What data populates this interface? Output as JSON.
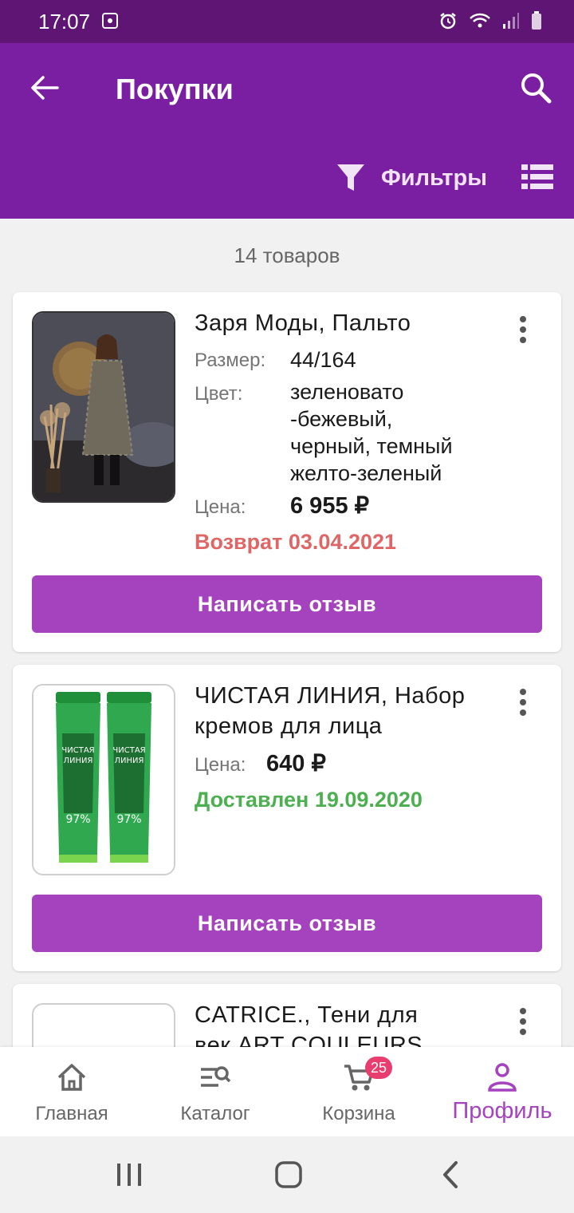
{
  "status_bar": {
    "time": "17:07"
  },
  "header": {
    "title": "Покупки",
    "filter_label": "Фильтры"
  },
  "summary": {
    "count_text": "14 товаров"
  },
  "labels": {
    "size": "Размер:",
    "color": "Цвет:",
    "price": "Цена:"
  },
  "products": [
    {
      "title": "Заря Моды, Пальто",
      "size": "44/164",
      "color_lines": [
        "зеленовато",
        "-бежевый,",
        "черный, темный",
        "желто-зеленый"
      ],
      "price": "6 955 ₽",
      "status": "Возврат 03.04.2021",
      "status_color": "#e06666",
      "button_label": "Написать отзыв"
    },
    {
      "title_lines": [
        "ЧИСТАЯ ЛИНИЯ, Набор",
        "кремов для лица"
      ],
      "price": "640 ₽",
      "status": "Доставлен 19.09.2020",
      "status_color": "#4caf50",
      "button_label": "Написать отзыв",
      "package_text": [
        "ЧИСТАЯ",
        "ЛИНИЯ",
        "97%"
      ]
    },
    {
      "title_lines": [
        "CATRICE., Тени для",
        "век ART COULEURS"
      ]
    }
  ],
  "bottom_nav": {
    "items": [
      {
        "label": "Главная",
        "icon": "home-icon"
      },
      {
        "label": "Каталог",
        "icon": "catalog-search-icon"
      },
      {
        "label": "Корзина",
        "icon": "cart-icon",
        "badge": "25"
      },
      {
        "label": "Профиль",
        "icon": "profile-icon",
        "active": true
      }
    ]
  },
  "colors": {
    "primary": "#7b1fa2",
    "status_bar": "#5f1574",
    "button": "#a543be",
    "badge": "#e83d6f"
  }
}
